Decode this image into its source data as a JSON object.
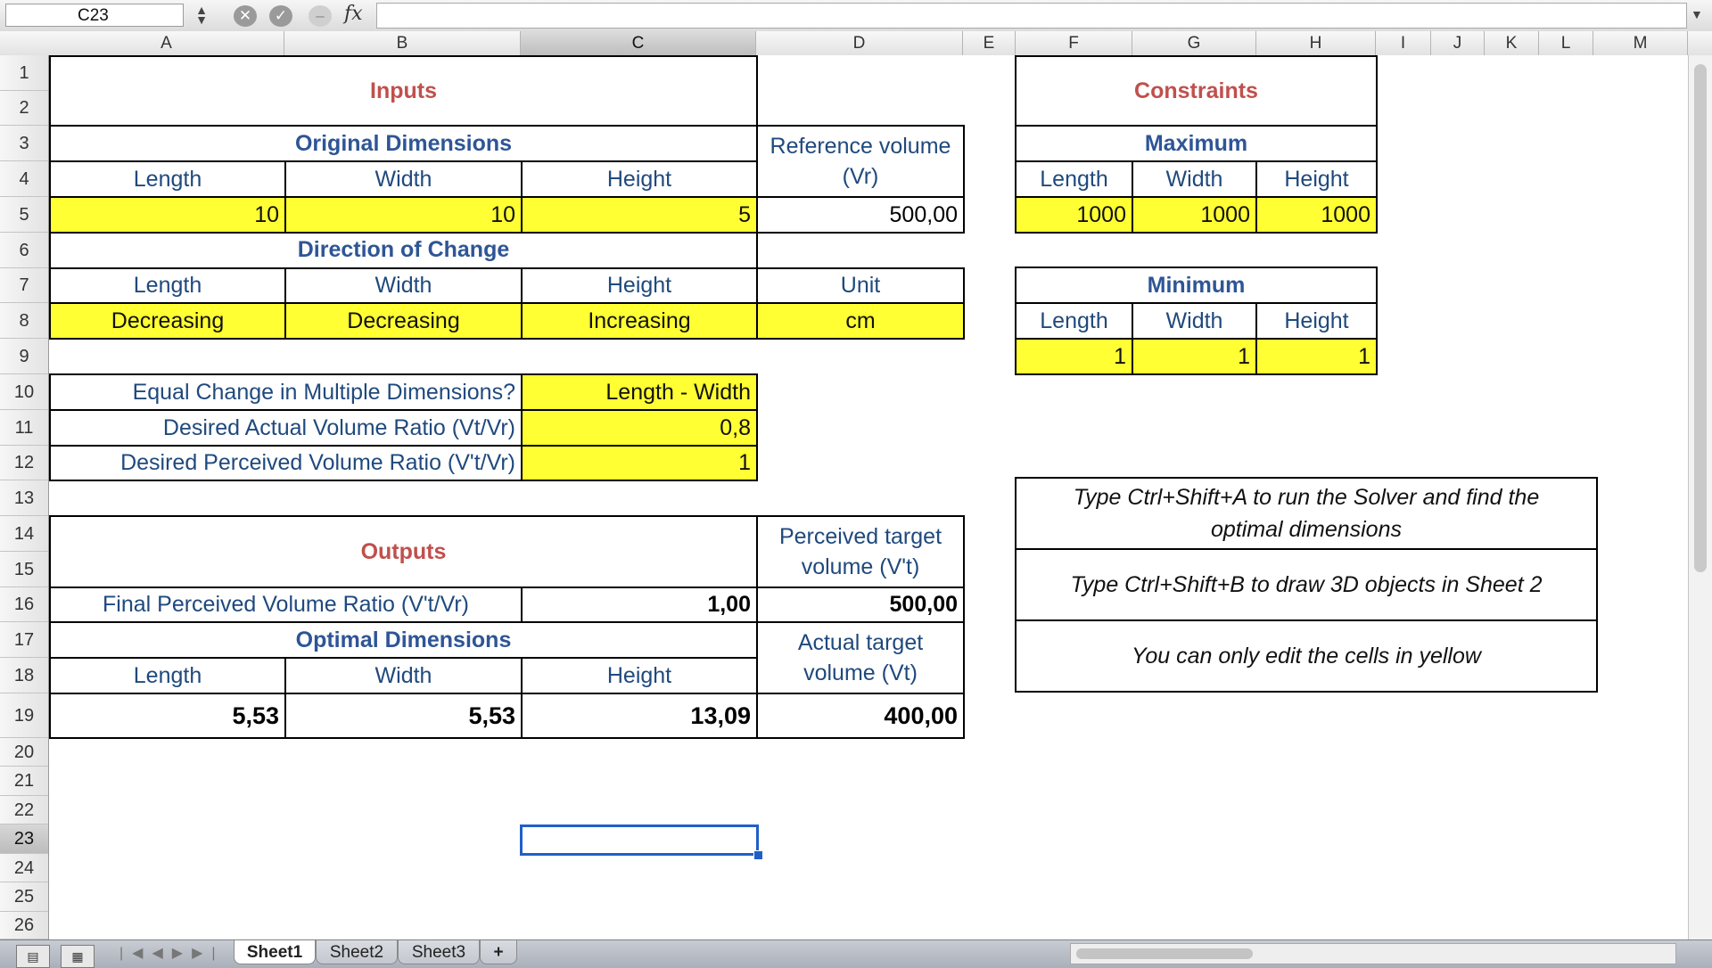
{
  "formula_bar": {
    "name_box": "C23",
    "fx_label": "fx",
    "formula": ""
  },
  "columns": [
    "A",
    "B",
    "C",
    "D",
    "E",
    "F",
    "G",
    "H",
    "I",
    "J",
    "K",
    "L",
    "M"
  ],
  "rows": [
    "1",
    "2",
    "3",
    "4",
    "5",
    "6",
    "7",
    "8",
    "9",
    "10",
    "11",
    "12",
    "13",
    "14",
    "15",
    "16",
    "17",
    "18",
    "19",
    "20",
    "21",
    "22",
    "23",
    "24",
    "25",
    "26"
  ],
  "cells": {
    "inputs_title": "Inputs",
    "original_dimensions": "Original Dimensions",
    "length": "Length",
    "width": "Width",
    "height": "Height",
    "orig_length": "10",
    "orig_width": "10",
    "orig_height": "5",
    "reference_volume_label": "Reference volume (Vr)",
    "reference_volume": "500,00",
    "direction_of_change": "Direction of Change",
    "unit_label": "Unit",
    "dir_length": "Decreasing",
    "dir_width": "Decreasing",
    "dir_height": "Increasing",
    "unit": "cm",
    "equal_change_label": "Equal Change in Multiple Dimensions?",
    "equal_change": "Length - Width",
    "desired_actual_label": "Desired Actual Volume Ratio (Vt/Vr)",
    "desired_actual": "0,8",
    "desired_perceived_label": "Desired Perceived Volume Ratio (V't/Vr)",
    "desired_perceived": "1",
    "outputs_title": "Outputs",
    "perceived_target_label": "Perceived target volume (V't)",
    "final_perceived_label": "Final Perceived Volume Ratio (V't/Vr)",
    "final_perceived": "1,00",
    "perceived_target": "500,00",
    "optimal_dimensions": "Optimal Dimensions",
    "actual_target_label": "Actual target volume (Vt)",
    "opt_length": "5,53",
    "opt_width": "5,53",
    "opt_height": "13,09",
    "actual_target": "400,00",
    "constraints_title": "Constraints",
    "maximum": "Maximum",
    "max_length": "1000",
    "max_width": "1000",
    "max_height": "1000",
    "minimum": "Minimum",
    "min_length": "1",
    "min_width": "1",
    "min_height": "1",
    "note_solver": "Type Ctrl+Shift+A to run the Solver and find the optimal dimensions",
    "note_draw": "Type Ctrl+Shift+B to draw 3D objects in Sheet 2",
    "note_edit": "You can only edit the cells in yellow"
  },
  "sheets": [
    "Sheet1",
    "Sheet2",
    "Sheet3"
  ],
  "add_sheet": "+",
  "colors": {
    "yellow": "#ffff33",
    "title_red": "#c0504d",
    "label_blue": "#1f497d",
    "selection": "#1f5fc9"
  }
}
